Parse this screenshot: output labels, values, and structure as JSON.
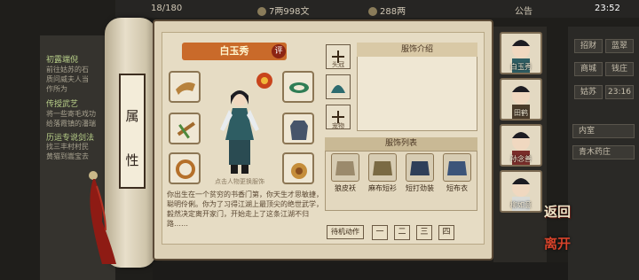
{
  "topbar": {
    "days": "18/180",
    "money": "7两998文",
    "points": "288两",
    "announce": "公告",
    "time": "23:52"
  },
  "left_quests": [
    {
      "title": "初露端倪",
      "text": "前往姑苏的石\n质问威夫人当\n作所为"
    },
    {
      "title": "传授武艺",
      "text": "将一些寄毛戏功\n给落霞镇的潘瑞"
    },
    {
      "title": "历运专说剑法",
      "text": "找三丰村村民\n黄猫到嵩宝去"
    }
  ],
  "rod": {
    "top_label": "属",
    "bottom_label": "性"
  },
  "character": {
    "name": "白玉秀",
    "ping_badge": "评",
    "hint": "点击人物更换服饰",
    "bio": "你出生在一个贫穷的书香门第，你天生才思敏捷，聪明伶俐。你为了习得江湖上最顶尖的绝世武学，毅然决定离开家门，开始走上了这条江湖不归路……"
  },
  "small_slots": [
    {
      "label": "头冠"
    },
    {
      "label": ""
    },
    {
      "label": "宠物"
    }
  ],
  "intro": {
    "title": "服饰介绍"
  },
  "costume_list": {
    "title": "服饰列表",
    "items": [
      {
        "label": "狼皮袄"
      },
      {
        "label": "麻布短衫"
      },
      {
        "label": "短打劲装"
      },
      {
        "label": "短布衣"
      }
    ]
  },
  "controls": {
    "idle_anim": "待机动作",
    "pages": [
      "一",
      "二",
      "三",
      "四"
    ]
  },
  "roster": [
    {
      "name": "白玉秀"
    },
    {
      "name": "田鹤"
    },
    {
      "name": "孙念善"
    },
    {
      "name": "柳如意"
    }
  ],
  "right_menu": {
    "row1": [
      "招财",
      "蓝翠"
    ],
    "row2": [
      "商城",
      "钱庄"
    ],
    "row3": [
      "姑苏",
      "23:16"
    ],
    "row4": "内室",
    "row5": "青木药庄"
  },
  "actions": {
    "back": "返回",
    "leave": "离开"
  }
}
